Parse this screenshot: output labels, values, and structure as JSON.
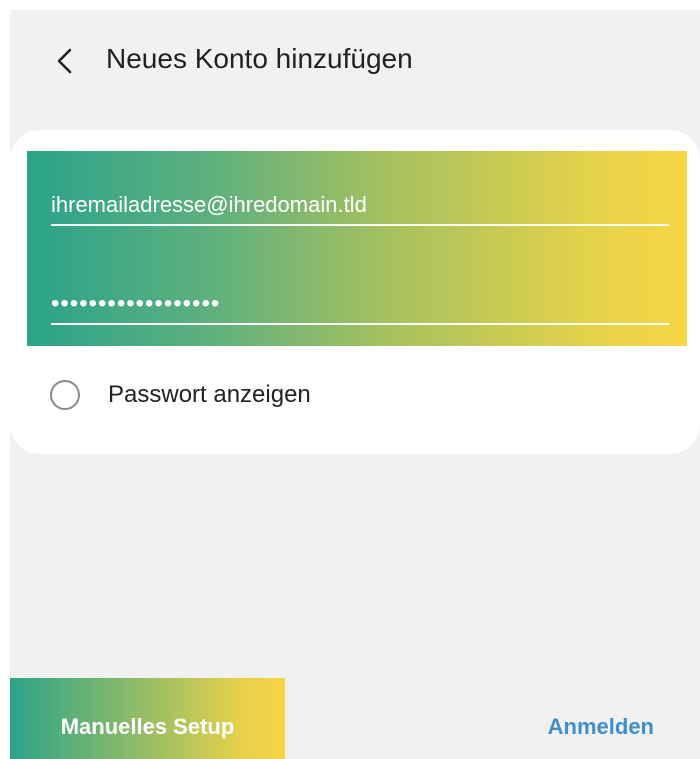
{
  "header": {
    "back_icon": "chevron-left-icon",
    "title": "Neues Konto hinzufügen"
  },
  "form": {
    "email_value": "ihremailadresse@ihredomain.tld",
    "password_value": "••••••••••••••••••",
    "show_password_label": "Passwort anzeigen",
    "show_password_checked": false
  },
  "actions": {
    "manual_setup_label": "Manuelles Setup",
    "login_label": "Anmelden"
  },
  "colors": {
    "background": "#f1f1f1",
    "card": "#ffffff",
    "gradient_start": "#2aa38a",
    "gradient_end": "#f8d545",
    "link": "#3e8fd0"
  }
}
